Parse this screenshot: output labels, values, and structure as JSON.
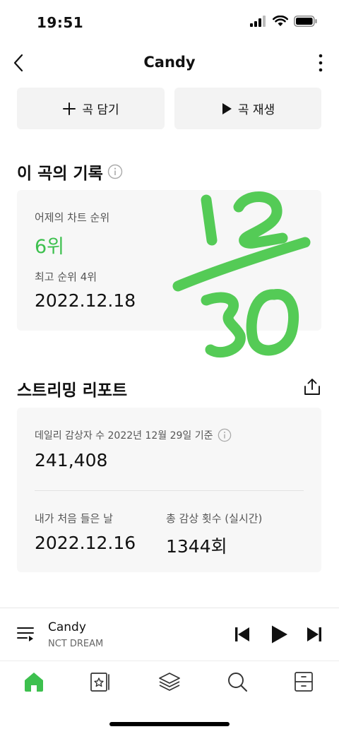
{
  "status": {
    "time": "19:51"
  },
  "nav": {
    "title": "Candy"
  },
  "actions": {
    "add_label": "곡 담기",
    "play_label": "곡 재생"
  },
  "record": {
    "title": "이 곡의 기록",
    "yesterday_label": "어제의 차트 순위",
    "yesterday_rank": "6위",
    "best_label": "최고 순위 4위",
    "best_date": "2022.12.18"
  },
  "report": {
    "title": "스트리밍 리포트",
    "daily_label": "데일리 감상자 수 2022년 12월 29일 기준",
    "daily_value": "241,408",
    "first_label": "내가 처음 들은 날",
    "first_value": "2022.12.16",
    "total_label": "총 감상 횟수 (실시간)",
    "total_value": "1344회"
  },
  "annotation": {
    "numerator": "12",
    "denominator": "30",
    "color": "#4cc94e"
  },
  "player": {
    "title": "Candy",
    "artist": "NCT DREAM"
  },
  "colors": {
    "accent": "#3dc04e"
  }
}
